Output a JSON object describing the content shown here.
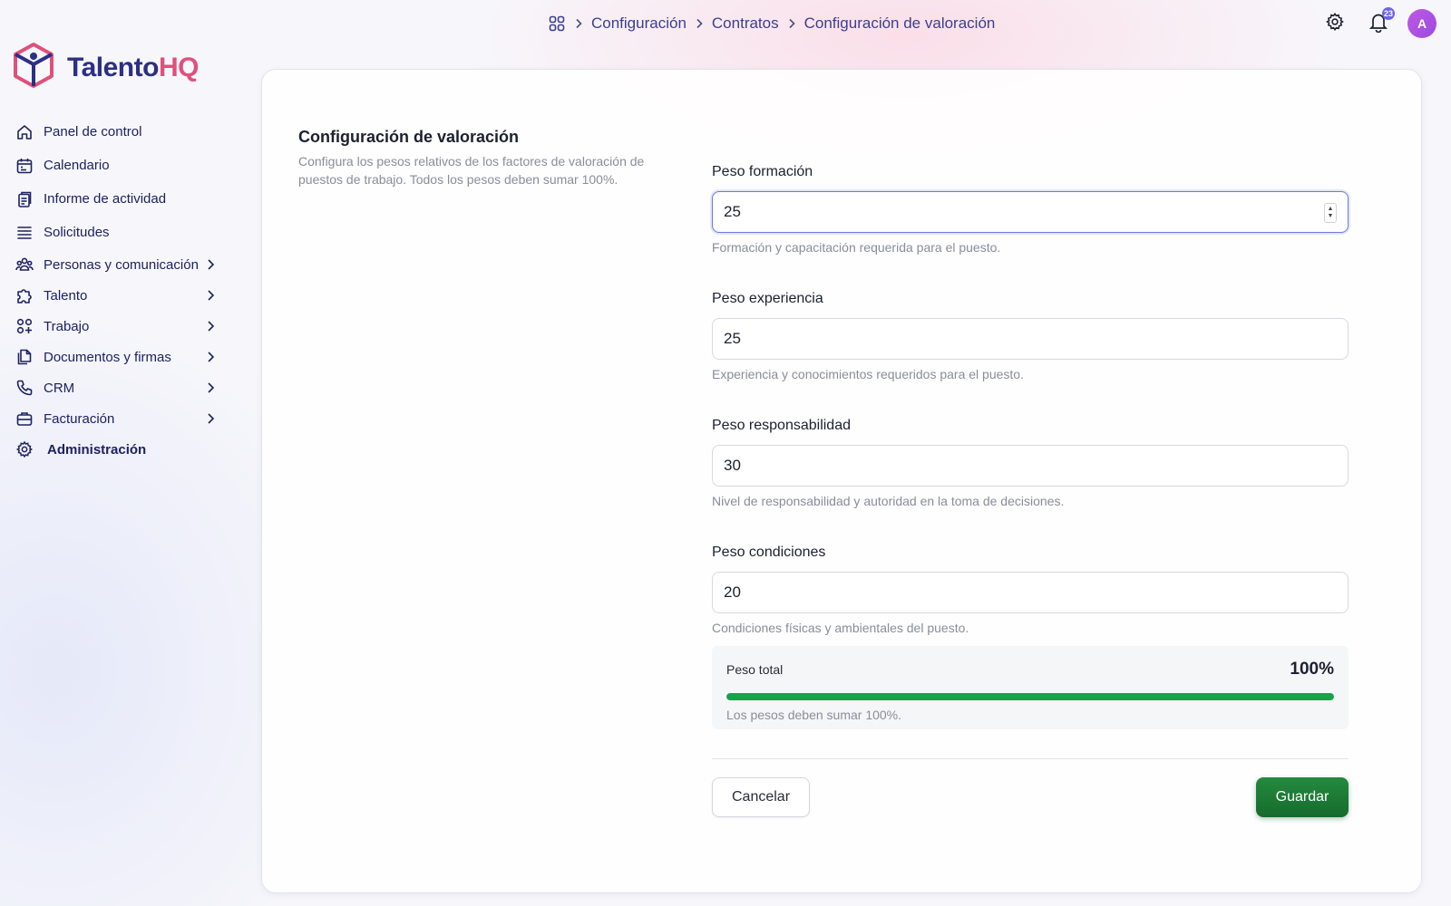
{
  "brand": {
    "name_part1": "Talento",
    "name_part2": "HQ",
    "color_primary": "#2c2f86",
    "color_accent": "#e0507a"
  },
  "breadcrumb": {
    "home_icon": "grid-icon",
    "items": [
      "Configuración",
      "Contratos",
      "Configuración de valoración"
    ]
  },
  "topbar": {
    "settings_icon": "gear-icon",
    "notifications_icon": "bell-icon",
    "notifications_count": "23",
    "avatar_initial": "A"
  },
  "sidebar": {
    "items": [
      {
        "label": "Panel de control",
        "icon": "home-icon"
      },
      {
        "label": "Calendario",
        "icon": "calendar-icon"
      },
      {
        "label": "Informe de actividad",
        "icon": "report-icon"
      },
      {
        "label": "Solicitudes",
        "icon": "list-icon"
      },
      {
        "label": "Personas y comunicación",
        "icon": "people-icon",
        "expandable": true
      },
      {
        "label": "Talento",
        "icon": "puzzle-icon",
        "expandable": true
      },
      {
        "label": "Trabajo",
        "icon": "apps-icon",
        "expandable": true
      },
      {
        "label": "Documentos y firmas",
        "icon": "documents-icon",
        "expandable": true
      },
      {
        "label": "CRM",
        "icon": "phone-icon",
        "expandable": true
      },
      {
        "label": "Facturación",
        "icon": "briefcase-icon",
        "expandable": true
      },
      {
        "label": "Administración",
        "icon": "gear-icon"
      }
    ]
  },
  "section": {
    "title": "Configuración de valoración",
    "description": "Configura los pesos relativos de los factores de valoración de puestos de trabajo. Todos los pesos deben sumar 100%."
  },
  "fields": [
    {
      "label": "Peso formación",
      "value": "25",
      "help": "Formación y capacitación requerida para el puesto."
    },
    {
      "label": "Peso experiencia",
      "value": "25",
      "help": "Experiencia y conocimientos requeridos para el puesto."
    },
    {
      "label": "Peso responsabilidad",
      "value": "30",
      "help": "Nivel de responsabilidad y autoridad en la toma de decisiones."
    },
    {
      "label": "Peso condiciones",
      "value": "20",
      "help": "Condiciones físicas y ambientales del puesto."
    }
  ],
  "total": {
    "label": "Peso total",
    "value": "100%",
    "progress": 1.0,
    "note": "Los pesos deben sumar 100%.",
    "bar_color": "#16a34a"
  },
  "actions": {
    "cancel_label": "Cancelar",
    "save_label": "Guardar",
    "save_color": "#1f7a37"
  }
}
